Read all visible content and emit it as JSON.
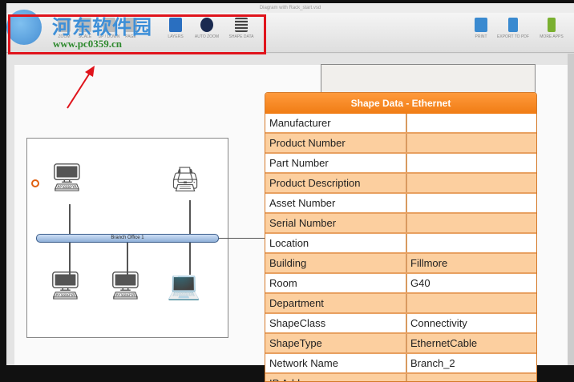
{
  "window": {
    "title": "Diagram with Rack_start.vsd"
  },
  "toolbar": {
    "left": [
      {
        "label": "ZOOM"
      },
      {
        "label": "SCALE"
      },
      {
        "label": "UP / DOWN"
      },
      {
        "label": "PAGE"
      },
      {
        "label": "LAYERS"
      },
      {
        "label": "AUTO ZOOM"
      },
      {
        "label": "SHAPE DATA"
      }
    ],
    "right": [
      {
        "label": "PRINT"
      },
      {
        "label": "EXPORT TO PDF"
      },
      {
        "label": "MORE APPS"
      }
    ]
  },
  "diagram": {
    "bus_label": "Branch Office 1"
  },
  "shape_data": {
    "title": "Shape Data - Ethernet",
    "rows": [
      {
        "name": "Manufacturer",
        "value": ""
      },
      {
        "name": "Product Number",
        "value": ""
      },
      {
        "name": "Part Number",
        "value": ""
      },
      {
        "name": "Product Description",
        "value": ""
      },
      {
        "name": "Asset Number",
        "value": ""
      },
      {
        "name": "Serial Number",
        "value": ""
      },
      {
        "name": "Location",
        "value": ""
      },
      {
        "name": "Building",
        "value": "Fillmore"
      },
      {
        "name": "Room",
        "value": "G40"
      },
      {
        "name": "Department",
        "value": ""
      },
      {
        "name": "ShapeClass",
        "value": "Connectivity"
      },
      {
        "name": "ShapeType",
        "value": "EthernetCable"
      },
      {
        "name": "Network Name",
        "value": "Branch_2"
      },
      {
        "name": "IP Address",
        "value": ""
      }
    ]
  },
  "watermark": {
    "name": "河东软件园",
    "url": "www.pc0359.cn"
  }
}
